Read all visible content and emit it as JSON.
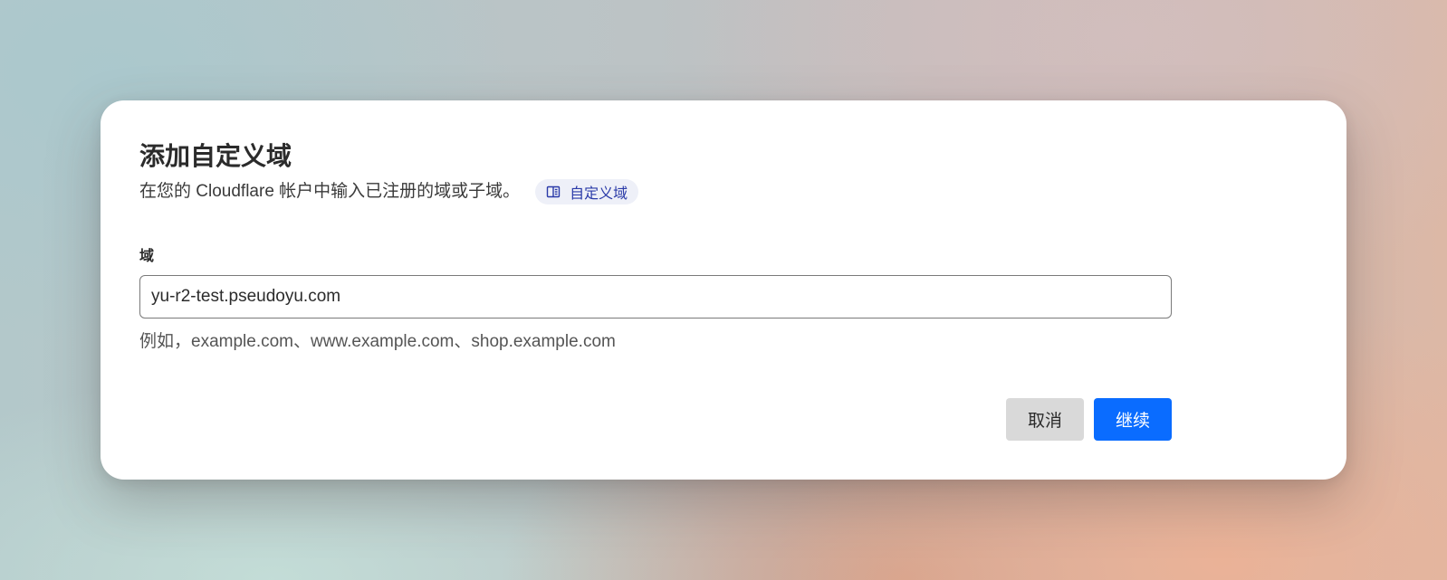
{
  "dialog": {
    "title": "添加自定义域",
    "subtitle": "在您的 Cloudflare 帐户中输入已注册的域或子域。",
    "docs_link": {
      "label": "自定义域",
      "icon": "book-icon"
    },
    "field": {
      "label": "域",
      "value": "yu-r2-test.pseudoyu.com",
      "hint": "例如，example.com、www.example.com、shop.example.com"
    },
    "buttons": {
      "cancel_label": "取消",
      "continue_label": "继续"
    },
    "colors": {
      "primary": "#0a6cff",
      "link": "#2a3aa8",
      "link_bg": "#eef0f8",
      "cancel_bg": "#d9d9d9"
    }
  }
}
